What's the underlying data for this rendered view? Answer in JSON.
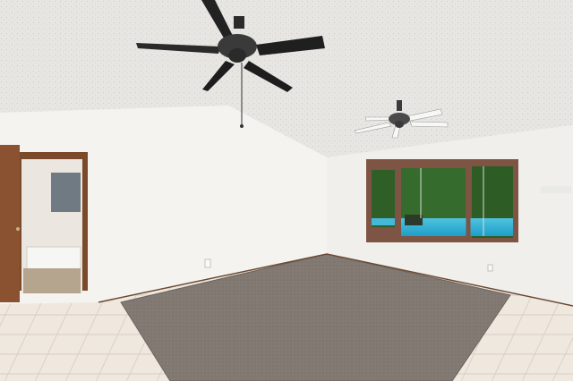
{
  "scene": {
    "description_visible_text": [],
    "colors": {
      "ceiling": "#e6e5e2",
      "left_wall": "#f4f3f0",
      "right_wall": "#f1f0ed",
      "carpet": "#837a73",
      "tile": "#efe9e1",
      "wood_trim": "#7a4a2a",
      "window_frame": "#7e5444",
      "pool_water": "#2fb2d6",
      "foliage": "#2f5e27",
      "fan_blade": "#1f1f1f"
    }
  }
}
